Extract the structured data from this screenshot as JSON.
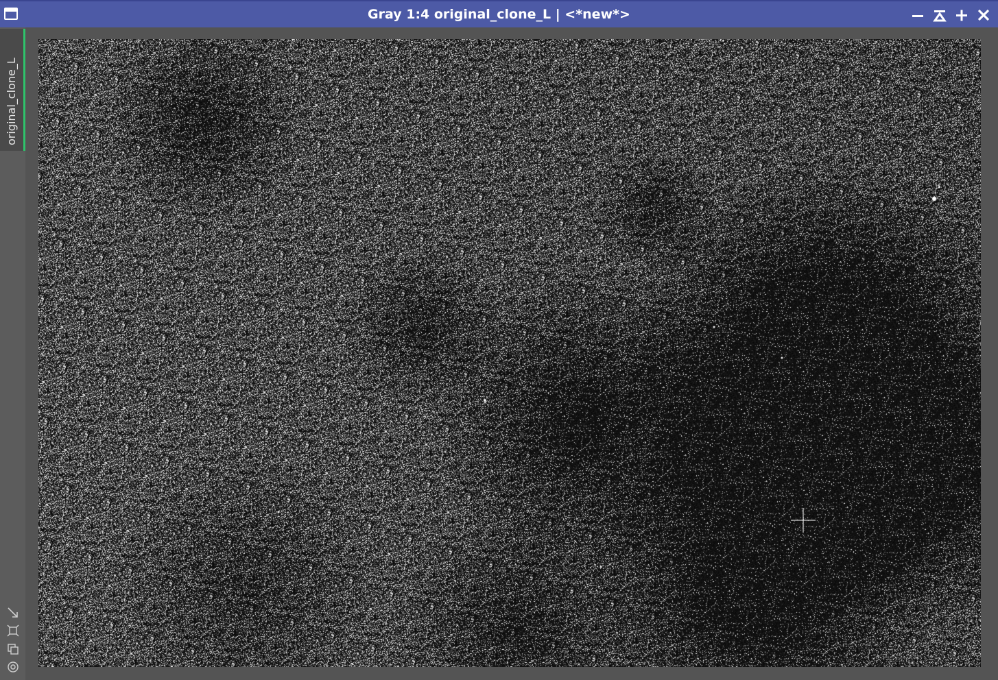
{
  "window": {
    "title": "Gray 1:4 original_clone_L | <*new*>",
    "controls": [
      "minimize-icon",
      "shade-icon",
      "maximize-icon",
      "close-icon"
    ]
  },
  "sidebar": {
    "tab_label": "original_clone_L",
    "tab_accent_color": "#2ec46b",
    "tool_icons": [
      "resize-icon",
      "fit-view-icon",
      "clone-icon",
      "target-icon"
    ]
  },
  "image": {
    "mode": "Gray",
    "zoom": "1:4",
    "content": "astronomical-image"
  },
  "colors": {
    "titlebar": "#4d5aa6",
    "background": "#545454"
  }
}
